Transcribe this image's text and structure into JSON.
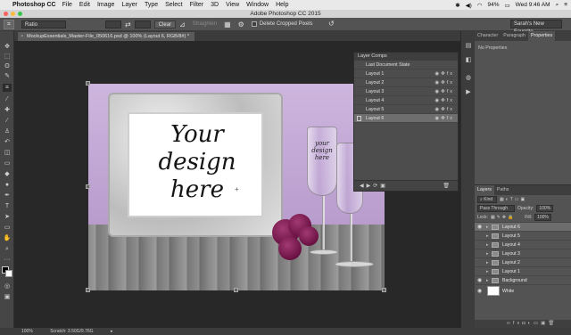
{
  "menubar": {
    "app": "Photoshop CC",
    "items": [
      "File",
      "Edit",
      "Image",
      "Layer",
      "Type",
      "Select",
      "Filter",
      "3D",
      "View",
      "Window",
      "Help"
    ],
    "battery": "94%",
    "clock": "Wed 9:46 AM"
  },
  "window": {
    "title": "Adobe Photoshop CC 2015"
  },
  "options": {
    "ratio": "Ratio",
    "clear": "Clear",
    "straighten": "Straighten",
    "delete_cropped": "Delete Cropped Pixels",
    "workspace": "Sarah's New Favorite"
  },
  "document": {
    "tab_title": "MockupEssentials_Master-File_050616.psd @ 100% (Layout 6, RGB/8#) *",
    "zoom": "100%",
    "scratch": "Scratch: 3.50G/9.76G",
    "design_text": [
      "Your",
      "design",
      "here"
    ],
    "glass_text": [
      "your",
      "design",
      "here"
    ]
  },
  "layer_comps": {
    "title": "Layer Comps",
    "last_state": "Last Document State",
    "rows": [
      "Layout 1",
      "Layout 2",
      "Layout 3",
      "Layout 4",
      "Layout 5",
      "Layout 6"
    ]
  },
  "properties": {
    "tabs": [
      "Character",
      "Paragraph",
      "Properties"
    ],
    "empty": "No Properties"
  },
  "layers_panel": {
    "tabs": [
      "Layers",
      "Paths"
    ],
    "kind": "Kind",
    "blend": "Pass Through",
    "opacity_label": "Opacity:",
    "opacity": "100%",
    "lock_label": "Lock:",
    "fill_label": "Fill:",
    "fill": "100%",
    "layers": [
      "Layout 6",
      "Layout 5",
      "Layout 4",
      "Layout 3",
      "Layout 2",
      "Layout 1",
      "Background",
      "White"
    ]
  },
  "colors": {
    "accent_selection": "#6d6d6d",
    "panel": "#535353",
    "canvas_bg": "#282828"
  }
}
